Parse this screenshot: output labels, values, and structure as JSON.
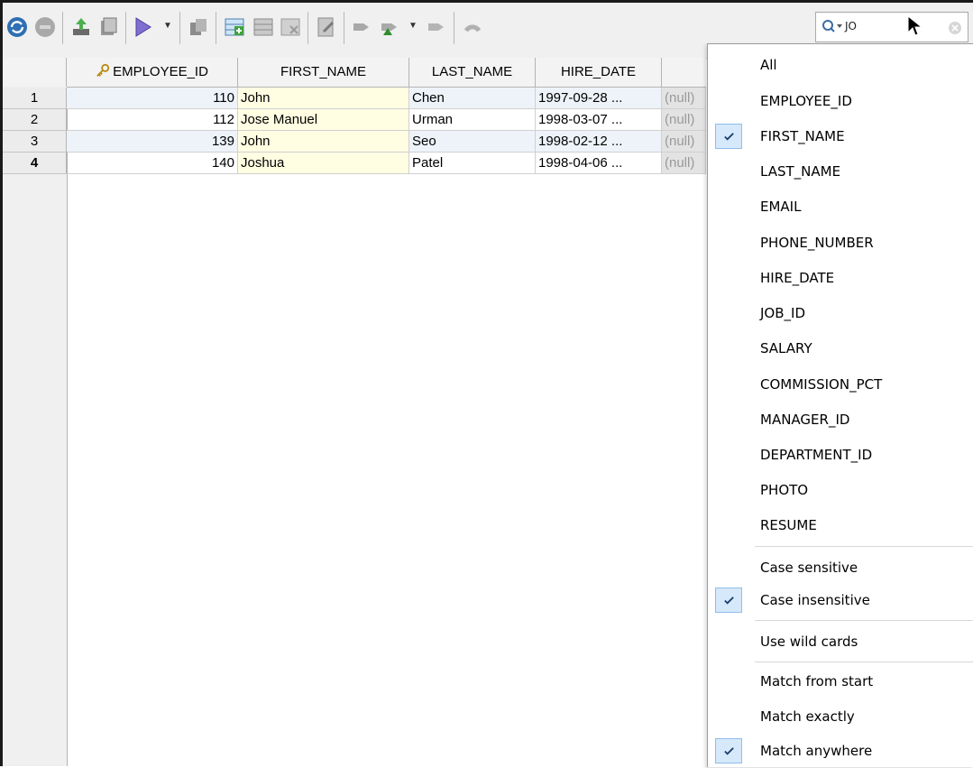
{
  "search": {
    "value": "JO"
  },
  "grid": {
    "columns": [
      "EMPLOYEE_ID",
      "FIRST_NAME",
      "LAST_NAME",
      "HIRE_DATE"
    ],
    "rows": [
      {
        "num": "1",
        "employee_id": "110",
        "first_name": "John",
        "last_name": "Chen",
        "hire_date": "1997-09-28 ...",
        "next": "(null)"
      },
      {
        "num": "2",
        "employee_id": "112",
        "first_name": "Jose Manuel",
        "last_name": "Urman",
        "hire_date": "1998-03-07 ...",
        "next": "(null)"
      },
      {
        "num": "3",
        "employee_id": "139",
        "first_name": "John",
        "last_name": "Seo",
        "hire_date": "1998-02-12 ...",
        "next": "(null)"
      },
      {
        "num": "4",
        "employee_id": "140",
        "first_name": "Joshua",
        "last_name": "Patel",
        "hire_date": "1998-04-06 ...",
        "next": "(null)"
      }
    ]
  },
  "menu": {
    "columns": [
      {
        "label": "All",
        "checked": false
      },
      {
        "label": "EMPLOYEE_ID",
        "checked": false
      },
      {
        "label": "FIRST_NAME",
        "checked": true
      },
      {
        "label": "LAST_NAME",
        "checked": false
      },
      {
        "label": "EMAIL",
        "checked": false
      },
      {
        "label": "PHONE_NUMBER",
        "checked": false
      },
      {
        "label": "HIRE_DATE",
        "checked": false
      },
      {
        "label": "JOB_ID",
        "checked": false
      },
      {
        "label": "SALARY",
        "checked": false
      },
      {
        "label": "COMMISSION_PCT",
        "checked": false
      },
      {
        "label": "MANAGER_ID",
        "checked": false
      },
      {
        "label": "DEPARTMENT_ID",
        "checked": false
      },
      {
        "label": "PHOTO",
        "checked": false
      },
      {
        "label": "RESUME",
        "checked": false
      }
    ],
    "case": [
      {
        "label": "Case sensitive",
        "checked": false
      },
      {
        "label": "Case insensitive",
        "checked": true
      }
    ],
    "wildcards": {
      "label": "Use wild cards",
      "checked": false
    },
    "match": [
      {
        "label": "Match from start",
        "checked": false
      },
      {
        "label": "Match exactly",
        "checked": false
      },
      {
        "label": "Match anywhere",
        "checked": true
      }
    ]
  },
  "colors": {
    "check_bg": "#d6e9fb",
    "check_border": "#8fbde9",
    "check_mark": "#1f3f6f",
    "first_name_bg": "#fffde2"
  }
}
